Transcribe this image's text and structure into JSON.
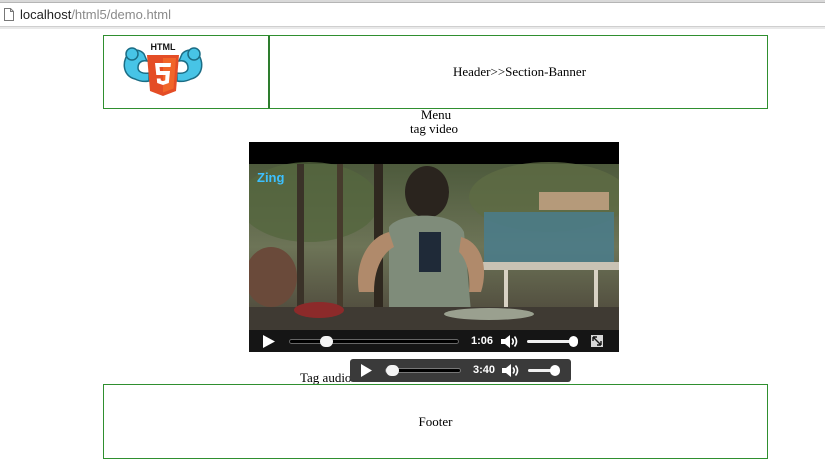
{
  "browser": {
    "url_host": "localhost",
    "url_path": "/html5/demo.html"
  },
  "header": {
    "logo_alt": "HTML5",
    "logo_text": "HTML",
    "logo_number": "5",
    "banner_text": "Header>>Section-Banner"
  },
  "menu_text": "Menu",
  "video": {
    "label": "tag video",
    "watermark": "Zing",
    "time": "1:06",
    "progress": 0.22,
    "volume": 0.95
  },
  "audio": {
    "label": "Tag audio",
    "time": "3:40",
    "progress": 0.05,
    "volume": 0.8
  },
  "footer_text": "Footer",
  "colors": {
    "border_green": "#2f8f2f",
    "html5_orange": "#e44d26",
    "mascot_blue": "#47c4e6",
    "control_bg": "#151515"
  }
}
